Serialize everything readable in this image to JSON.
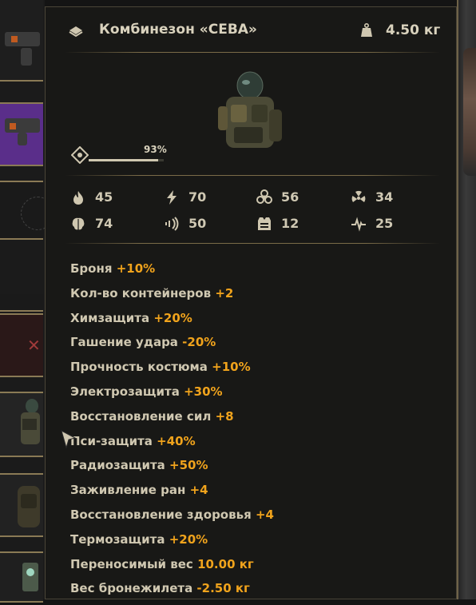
{
  "item": {
    "name": "Комбинезон «СЕВА»",
    "weight": "4.50 кг",
    "durability": "93%",
    "durability_value": 0.93
  },
  "resistances": [
    {
      "icon": "fire-icon",
      "value": "45"
    },
    {
      "icon": "lightning-icon",
      "value": "70"
    },
    {
      "icon": "biohazard-icon",
      "value": "56"
    },
    {
      "icon": "radiation-icon",
      "value": "34"
    },
    {
      "icon": "brain-psy-icon",
      "value": "74"
    },
    {
      "icon": "shockwave-icon",
      "value": "50"
    },
    {
      "icon": "vest-armor-icon",
      "value": "12"
    },
    {
      "icon": "heartbeat-icon",
      "value": "25"
    }
  ],
  "bonuses": [
    {
      "name": "Броня",
      "value": "+10%"
    },
    {
      "name": "Кол-во контейнеров",
      "value": "+2"
    },
    {
      "name": "Химзащита",
      "value": "+20%"
    },
    {
      "name": "Гашение удара",
      "value": "-20%"
    },
    {
      "name": "Прочность костюма",
      "value": "+10%"
    },
    {
      "name": "Электрозащита",
      "value": "+30%"
    },
    {
      "name": "Восстановление сил",
      "value": "+8"
    },
    {
      "name": "Пси-защита",
      "value": "+40%"
    },
    {
      "name": "Радиозащита",
      "value": "+50%"
    },
    {
      "name": "Заживление ран",
      "value": "+4"
    },
    {
      "name": "Восстановление здоровья",
      "value": "+4"
    },
    {
      "name": "Термозащита",
      "value": "+20%"
    },
    {
      "name": "Переносимый вес",
      "value": "10.00 кг"
    },
    {
      "name": "Вес бронежилета",
      "value": "-2.50 кг"
    }
  ],
  "colors": {
    "accent": "#f0a31c",
    "text": "#d0c8b1",
    "panel_bg": "#181816",
    "divider": "#7a6b48",
    "rare_slot": "#5a2e8a"
  }
}
